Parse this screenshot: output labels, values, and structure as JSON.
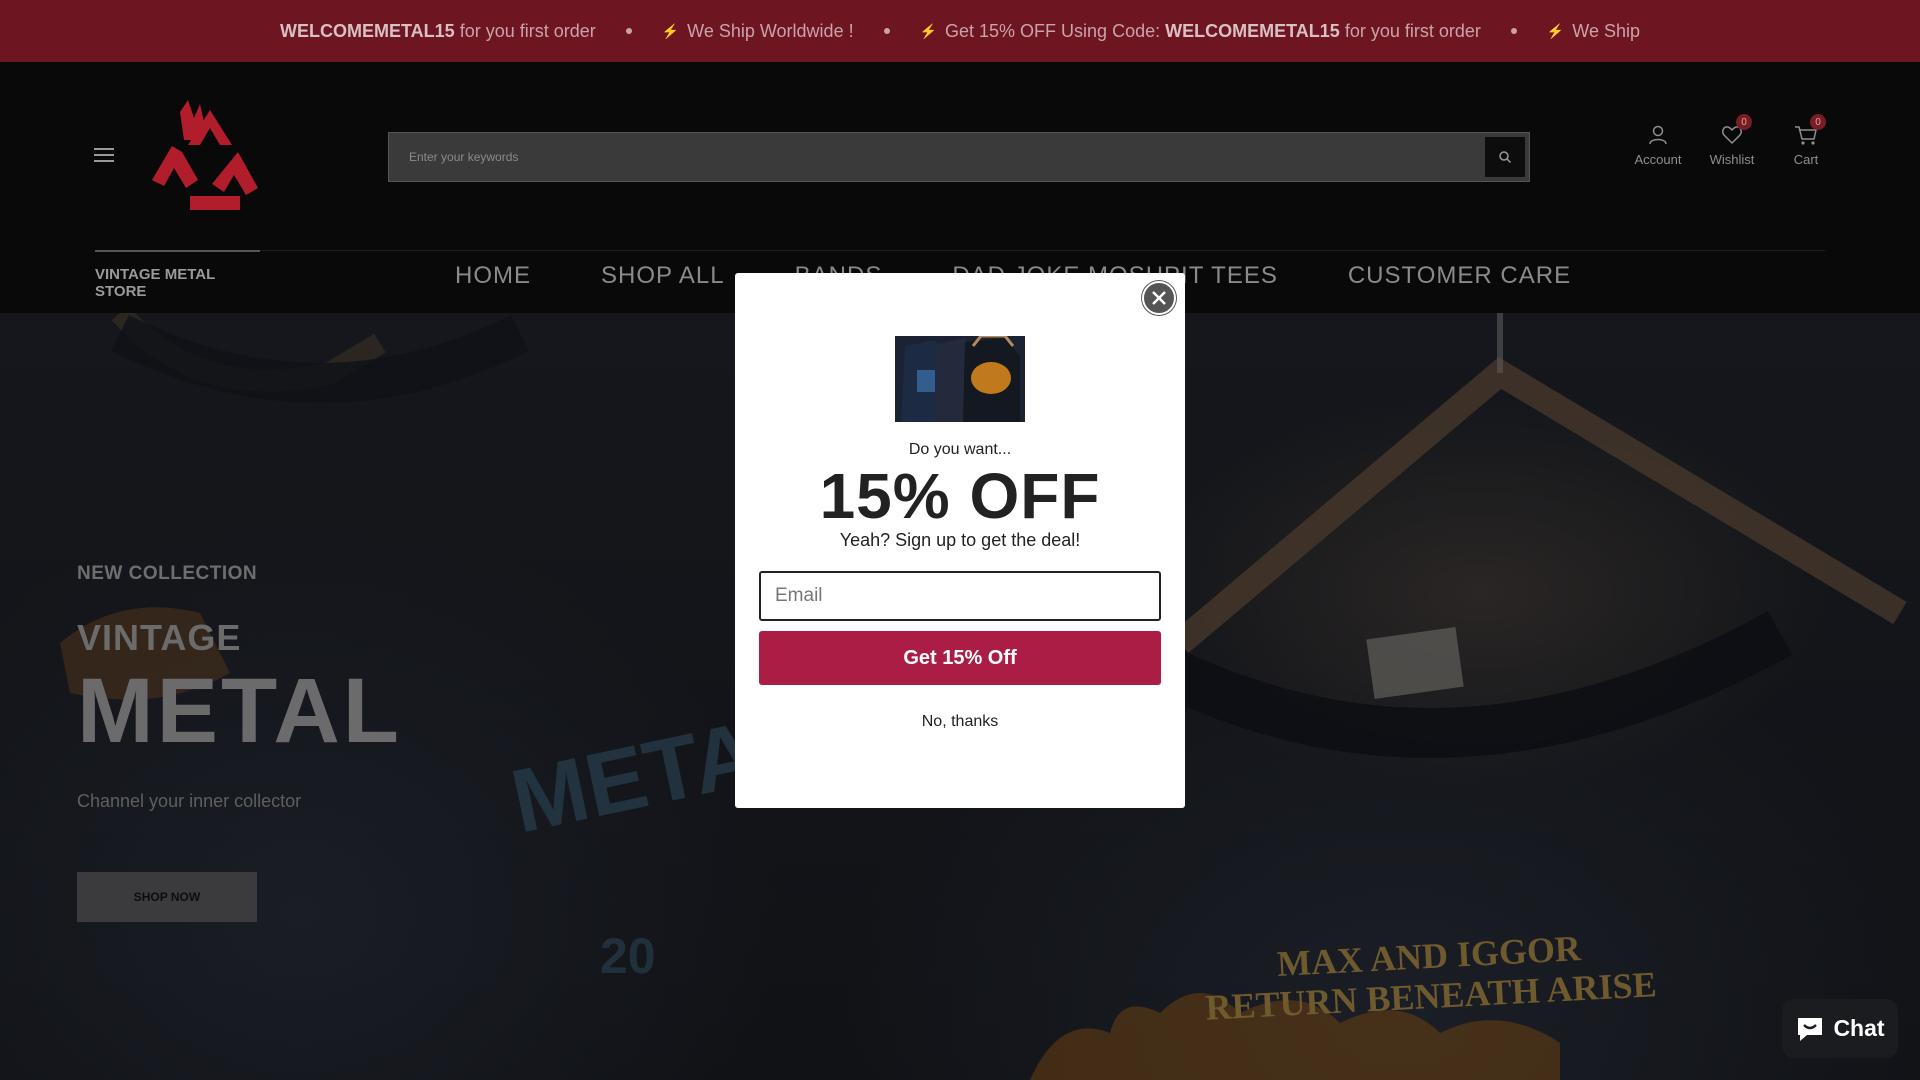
{
  "announcement": {
    "seg1_code": "WELCOMEMETAL15",
    "seg1_rest": "for you first order",
    "seg2": "We Ship Worldwide !",
    "seg3_pre": "Get 15% OFF Using Code:",
    "seg3_code": "WELCOMEMETAL15",
    "seg3_rest": "for you first order",
    "seg4": "We Ship"
  },
  "header": {
    "search_placeholder": "Enter your keywords",
    "account_label": "Account",
    "wishlist_label": "Wishlist",
    "wishlist_count": "0",
    "cart_label": "Cart",
    "cart_count": "0",
    "store_tab": "VINTAGE METAL STORE"
  },
  "nav": {
    "items": [
      "HOME",
      "SHOP ALL",
      "BANDS",
      "DAD JOKE MOSHPIT TEES",
      "CUSTOMER CARE"
    ]
  },
  "hero": {
    "eyebrow": "NEW COLLECTION",
    "line1": "VINTAGE",
    "line2": "METAL",
    "subtitle": "Channel your inner collector",
    "button": "SHOP NOW",
    "shirt_text_1": "MAX AND IGGOR",
    "shirt_text_2": "RETURN BENEATH ARISE"
  },
  "popup": {
    "pre": "Do you want...",
    "headline": "15% OFF",
    "subline": "Yeah? Sign up to get the deal!",
    "email_placeholder": "Email",
    "cta": "Get 15% Off",
    "decline": "No, thanks"
  },
  "chat": {
    "label": "Chat"
  },
  "colors": {
    "announcement_bg": "#6d1622",
    "cta_bg": "#ab1d45",
    "logo_red": "#b11d2b"
  }
}
